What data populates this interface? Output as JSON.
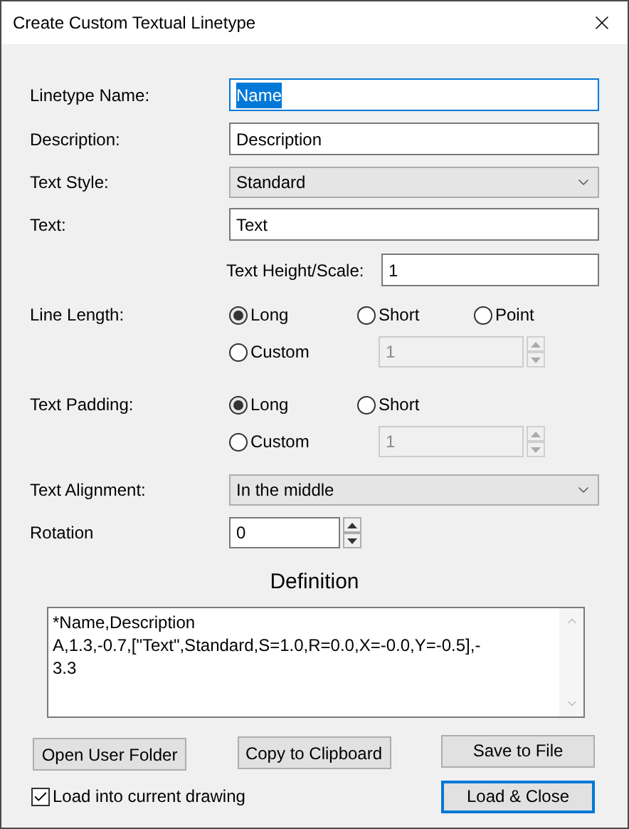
{
  "window": {
    "title": "Create Custom Textual Linetype"
  },
  "linetype_name": {
    "label": "Linetype Name:",
    "value": "Name",
    "focused": true
  },
  "description": {
    "label": "Description:",
    "value": "Description"
  },
  "text_style": {
    "label": "Text Style:",
    "value": "Standard"
  },
  "text": {
    "label": "Text:",
    "value": "Text"
  },
  "text_height": {
    "label": "Text Height/Scale:",
    "value": "1"
  },
  "line_length": {
    "label": "Line Length:",
    "options": [
      {
        "label": "Long",
        "kind": "preset",
        "selected": true
      },
      {
        "label": "Short",
        "kind": "preset",
        "selected": false
      },
      {
        "label": "Point",
        "kind": "preset",
        "selected": false
      },
      {
        "label": "Custom",
        "kind": "custom",
        "selected": false
      }
    ],
    "custom_value": "1",
    "custom_disabled": true
  },
  "text_padding": {
    "label": "Text Padding:",
    "options": [
      {
        "label": "Long",
        "kind": "preset",
        "selected": true
      },
      {
        "label": "Short",
        "kind": "preset",
        "selected": false
      },
      {
        "label": "Custom",
        "kind": "custom",
        "selected": false
      }
    ],
    "custom_value": "1",
    "custom_disabled": true
  },
  "text_alignment": {
    "label": "Text Alignment:",
    "value": "In the middle"
  },
  "rotation": {
    "label": "Rotation",
    "value": "0"
  },
  "definition": {
    "title": "Definition",
    "lines": [
      "*Name,Description",
      "A,1.3,-0.7,[\"Text\",Standard,S=1.0,R=0.0,X=-0.0,Y=-0.5],-",
      "3.3"
    ]
  },
  "buttons": [
    {
      "label": "Open User Folder",
      "default": false
    },
    {
      "label": "Copy to Clipboard",
      "default": false
    },
    {
      "label": "Save to File",
      "default": false
    },
    {
      "label": "Load & Close",
      "default": true
    }
  ],
  "load_checkbox": {
    "label": "Load into current drawing",
    "checked": true
  }
}
